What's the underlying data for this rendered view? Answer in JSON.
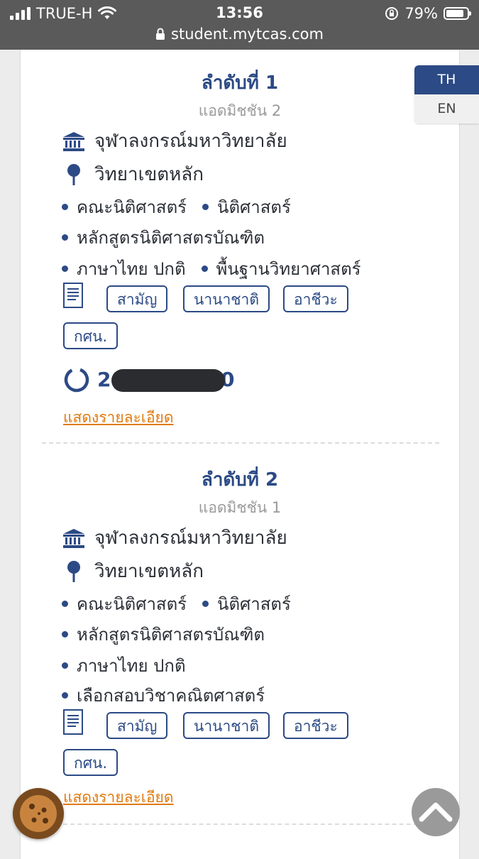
{
  "status_bar": {
    "carrier": "TRUE-H",
    "time": "13:56",
    "battery": "79%",
    "battery_level": 0.79,
    "url": "student.mytcas.com"
  },
  "lang": {
    "th": "TH",
    "en": "EN"
  },
  "entries": [
    {
      "rank_title": "ลำดับที่ 1",
      "round": "แอดมิชชัน 2",
      "university": "จุฬาลงกรณ์มหาวิทยาลัย",
      "campus": "วิทยาเขตหลัก",
      "faculty": "คณะนิติศาสตร์",
      "field": "นิติศาสตร์",
      "program": "หลักสูตรนิติศาสตรบัณฑิต",
      "language": "ภาษาไทย ปกติ",
      "extra": "พื้นฐานวิทยาศาสตร์",
      "tags": [
        "สามัญ",
        "นานาชาติ",
        "อาชีวะ",
        "กศน."
      ],
      "code_start": "2",
      "code_end": "0",
      "detail_link": "แสดงรายละเอียด"
    },
    {
      "rank_title": "ลำดับที่ 2",
      "round": "แอดมิชชัน 1",
      "university": "จุฬาลงกรณ์มหาวิทยาลัย",
      "campus": "วิทยาเขตหลัก",
      "faculty": "คณะนิติศาสตร์",
      "field": "นิติศาสตร์",
      "program": "หลักสูตรนิติศาสตรบัณฑิต",
      "language": "ภาษาไทย ปกติ",
      "extra": "เลือกสอบวิชาคณิตศาสตร์",
      "tags": [
        "สามัญ",
        "นานาชาติ",
        "อาชีวะ",
        "กศน."
      ],
      "detail_link": "แสดงรายละเอียด"
    }
  ],
  "colors": {
    "primary": "#2c4a85",
    "link": "#e07a10"
  }
}
